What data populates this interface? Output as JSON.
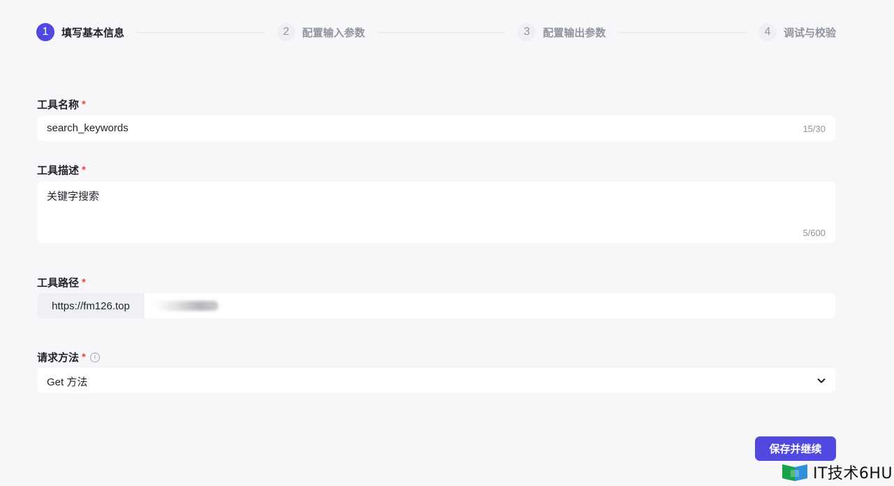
{
  "stepper": {
    "steps": [
      {
        "num": "1",
        "label": "填写基本信息"
      },
      {
        "num": "2",
        "label": "配置输入参数"
      },
      {
        "num": "3",
        "label": "配置输出参数"
      },
      {
        "num": "4",
        "label": "调试与校验"
      }
    ],
    "active_step": "1"
  },
  "form": {
    "name": {
      "label": "工具名称",
      "required_mark": "*",
      "value": "search_keywords",
      "counter": "15/30"
    },
    "description": {
      "label": "工具描述",
      "required_mark": "*",
      "value": "关键字搜索",
      "counter": "5/600"
    },
    "path": {
      "label": "工具路径",
      "required_mark": "*",
      "prefix": "https://fm126.top"
    },
    "method": {
      "label": "请求方法",
      "required_mark": "*",
      "info_icon": "info-icon",
      "value": "Get 方法",
      "chevron_icon": "chevron-down-icon"
    }
  },
  "actions": {
    "submit_label": "保存并继续"
  },
  "watermark": {
    "text": "IT技术6HU"
  },
  "colors": {
    "accent": "#5148e0",
    "required": "#e5484d",
    "background": "#f7f7f9"
  }
}
